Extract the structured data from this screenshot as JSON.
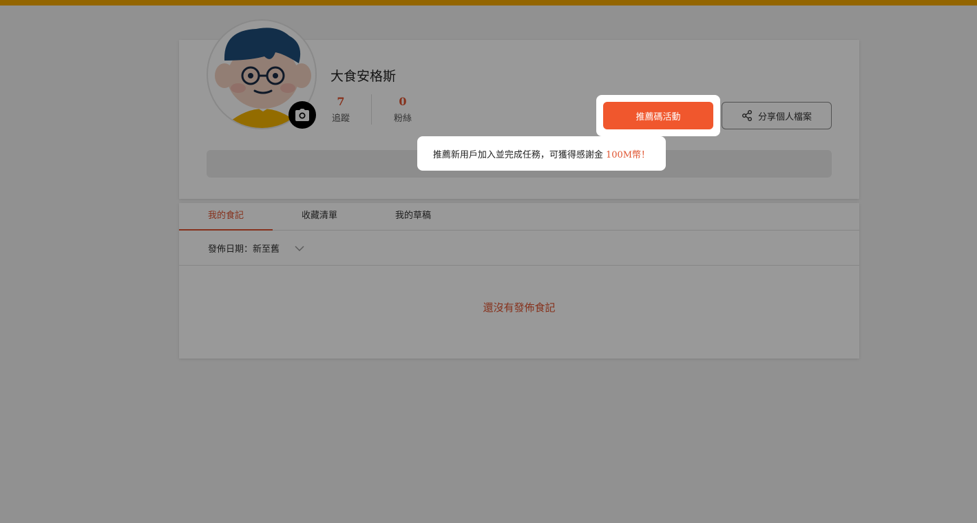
{
  "colors": {
    "accent": "#e0532f",
    "button": "#f0572d",
    "top_bar": "#f5a900"
  },
  "profile": {
    "username": "大食安格斯",
    "following_count": "7",
    "following_label": "追蹤",
    "followers_count": "0",
    "followers_label": "粉絲",
    "share_label": "分享個人檔案"
  },
  "referral": {
    "button_label": "推薦碼活動",
    "tooltip_text": "推薦新用戶加入並完成任務，可獲得感謝金",
    "tooltip_highlight": "100M幣！"
  },
  "tabs": [
    {
      "label": "我的食記",
      "active": true
    },
    {
      "label": "收藏清單",
      "active": false
    },
    {
      "label": "我的草稿",
      "active": false
    }
  ],
  "sort": {
    "label": "發佈日期：新至舊"
  },
  "empty_message": "還沒有發佈食記",
  "icons": [
    "camera-icon",
    "share-icon",
    "chevron-down-icon"
  ]
}
